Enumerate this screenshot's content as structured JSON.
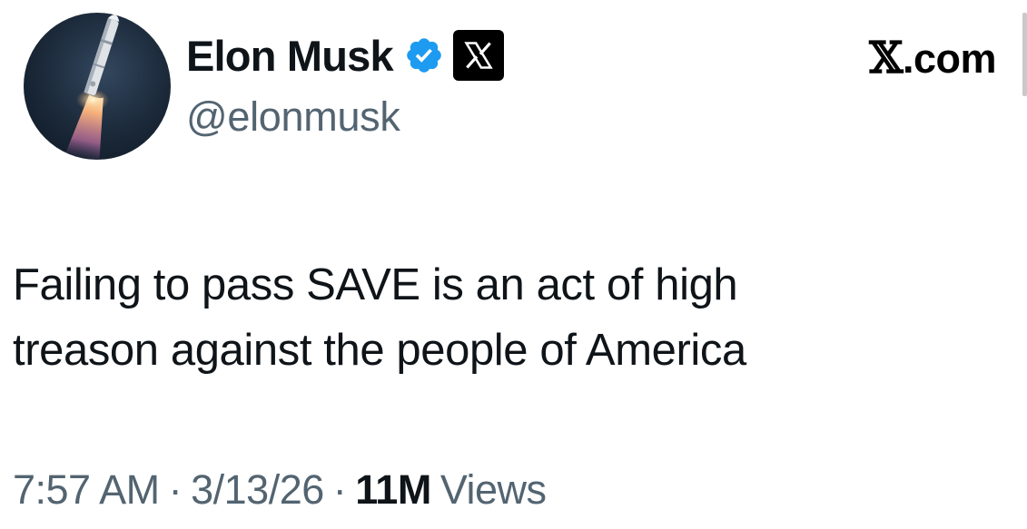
{
  "author": {
    "display_name": "Elon Musk",
    "handle": "@elonmusk",
    "avatar_icon": "rocket-launch-avatar",
    "verified_icon": "verified-badge-icon",
    "affiliate_icon": "x-logo-icon"
  },
  "site_label": {
    "glyph": "𝕏",
    "suffix": ".com"
  },
  "tweet": {
    "text_lines": [
      "Failing to pass SAVE is an act of high",
      "treason against the people of America"
    ]
  },
  "meta": {
    "time": "7:57 AM",
    "separator": "·",
    "date": "3/13/26",
    "views_count": "11M",
    "views_label": "Views"
  },
  "colors": {
    "primary_text": "#0f1419",
    "secondary_text": "#536471",
    "verified_blue": "#1d9bf0",
    "background": "#ffffff"
  }
}
